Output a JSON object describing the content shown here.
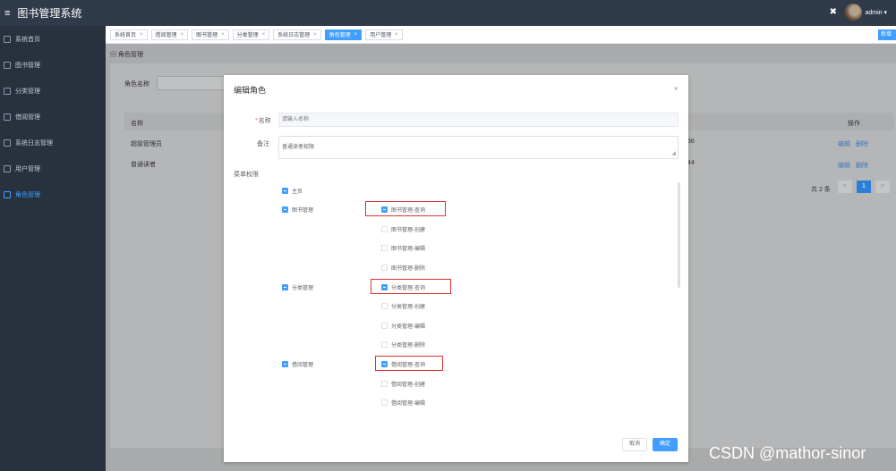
{
  "app": {
    "title": "图书管理系统",
    "user": "admin"
  },
  "sidebar": {
    "items": [
      {
        "label": "系统首页"
      },
      {
        "label": "图书管理"
      },
      {
        "label": "分类管理"
      },
      {
        "label": "借阅管理"
      },
      {
        "label": "系统日志管理"
      },
      {
        "label": "用户管理"
      },
      {
        "label": "角色管理",
        "active": true
      }
    ]
  },
  "tabs": [
    {
      "label": "系统首页"
    },
    {
      "label": "借阅管理"
    },
    {
      "label": "图书管理"
    },
    {
      "label": "分类管理"
    },
    {
      "label": "系统日志管理"
    },
    {
      "label": "角色管理",
      "active": true
    },
    {
      "label": "用户管理"
    }
  ],
  "corner_button": "新增",
  "breadcrumb": "角色管理",
  "filter": {
    "label": "角色名称"
  },
  "table": {
    "headers": {
      "name": "名称",
      "operation": "操作"
    },
    "rows": [
      {
        "name": "超级管理员",
        "time": ":36",
        "edit": "编辑",
        "delete": "删除"
      },
      {
        "name": "普通读者",
        "time": ":44",
        "edit": "编辑",
        "delete": "删除"
      }
    ]
  },
  "pagination": {
    "total": "共 2 条",
    "page": "1",
    "prev": "<",
    "next": ">"
  },
  "dialog": {
    "title": "编辑角色",
    "close": "×",
    "name_label": "名称",
    "name_placeholder": "请输入名称",
    "remark_label": "备注",
    "remark_value": "普通读者权限",
    "perm_label": "菜单权限",
    "perms": {
      "home": "主页",
      "book": "图书管理",
      "book_query": "图书管理-查询",
      "book_create": "图书管理-创建",
      "book_edit": "图书管理-编辑",
      "book_delete": "图书管理-删除",
      "cat": "分类管理",
      "cat_query": "分类管理-查询",
      "cat_create": "分类管理-创建",
      "cat_edit": "分类管理-编辑",
      "cat_delete": "分类管理-删除",
      "borrow": "借阅管理",
      "borrow_query": "借阅管理-查询",
      "borrow_create": "借阅管理-创建",
      "borrow_edit": "借阅管理-编辑"
    },
    "cancel": "取消",
    "ok": "确定"
  },
  "watermark": "CSDN @mathor-sinor",
  "colors": {
    "accent": "#409eff",
    "highlight": "#e03131",
    "topbar": "#2f3a4a",
    "sidebar": "#28323f"
  }
}
